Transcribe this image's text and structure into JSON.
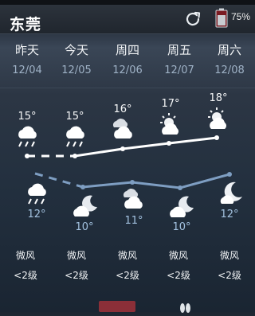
{
  "header": {
    "city": "东莞",
    "battery": "75%",
    "icons": [
      "refresh-icon",
      "battery-icon"
    ]
  },
  "days": [
    {
      "name": "昨天",
      "date": "12/04",
      "high": "15°",
      "low": "12°",
      "day_icon": "sleet-icon",
      "night_icon": "sleet-icon",
      "wind": "微风",
      "wind_level": "<2级"
    },
    {
      "name": "今天",
      "date": "12/05",
      "high": "15°",
      "low": "10°",
      "day_icon": "sleet-icon",
      "night_icon": "cloudy-night-icon",
      "wind": "微风",
      "wind_level": "<2级"
    },
    {
      "name": "周四",
      "date": "12/06",
      "high": "16°",
      "low": "11°",
      "day_icon": "partly-cloudy-icon",
      "night_icon": "cloudy-icon",
      "wind": "微风",
      "wind_level": "<2级"
    },
    {
      "name": "周五",
      "date": "12/07",
      "high": "17°",
      "low": "10°",
      "day_icon": "partly-sunny-icon",
      "night_icon": "cloudy-night-icon",
      "wind": "微风",
      "wind_level": "<2级"
    },
    {
      "name": "周六",
      "date": "12/08",
      "high": "18°",
      "low": "12°",
      "day_icon": "partly-sunny-icon",
      "night_icon": "moon-icon",
      "wind": "微风",
      "wind_level": "<2级"
    }
  ],
  "colors": {
    "high_line": "#ffffff",
    "low_line": "#7e9ec2"
  }
}
